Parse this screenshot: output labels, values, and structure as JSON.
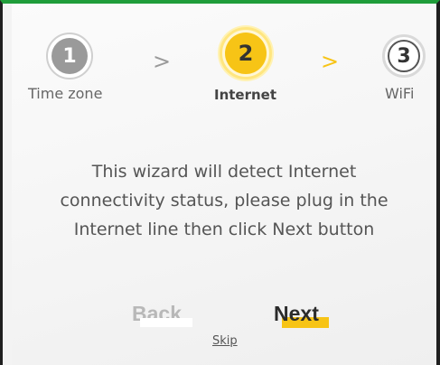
{
  "steps": [
    {
      "number": "1",
      "label": "Time zone",
      "state": "completed"
    },
    {
      "number": "2",
      "label": "Internet",
      "state": "active"
    },
    {
      "number": "3",
      "label": "WiFi",
      "state": "pending"
    }
  ],
  "separators": [
    ">",
    ">"
  ],
  "message": "This wizard will detect Internet connectivity status, please plug in the Internet line then click Next button",
  "buttons": {
    "back": "Back",
    "next": "Next",
    "skip": "Skip"
  },
  "colors": {
    "accent": "#f7c416",
    "inactive": "#9a9a9a",
    "top_bar": "#1f9d3a"
  }
}
